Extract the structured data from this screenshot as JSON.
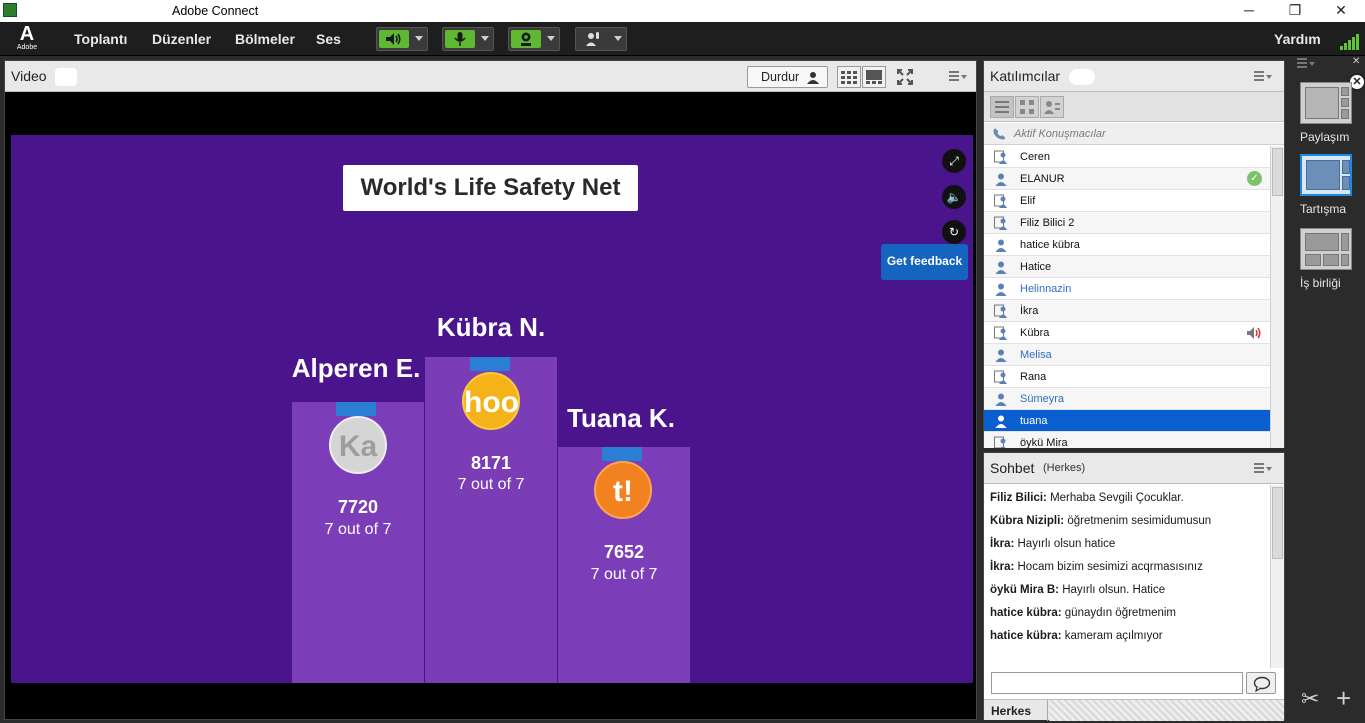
{
  "window": {
    "title": "Adobe Connect",
    "controls": [
      "─",
      "❐",
      "✕"
    ]
  },
  "menubar": {
    "logo_letter": "A",
    "logo_text": "Adobe",
    "items": [
      "Toplantı",
      "Düzenler",
      "Bölmeler",
      "Ses"
    ],
    "help": "Yardım"
  },
  "video": {
    "title": "Video",
    "stop_label": "Durdur",
    "stage": {
      "banner": "World's Life Safety Net",
      "feedback": "Get feedback",
      "podium": [
        {
          "name": "Alperen E.",
          "badge": "Ka",
          "score": "7720",
          "correct": "7 out of 7"
        },
        {
          "name": "Kübra N.",
          "badge": "hoo",
          "score": "8171",
          "correct": "7 out of 7"
        },
        {
          "name": "Tuana K.",
          "badge": "t!",
          "score": "7652",
          "correct": "7 out of 7"
        }
      ]
    }
  },
  "participants": {
    "title": "Katılımcılar",
    "active_speakers": "Aktif Konuşmacılar",
    "list": [
      {
        "name": "Ceren",
        "role": "host",
        "status": ""
      },
      {
        "name": "ELANUR",
        "role": "participant",
        "status": "check-icon"
      },
      {
        "name": "Elif",
        "role": "host",
        "status": ""
      },
      {
        "name": "Filiz Bilici 2",
        "role": "host",
        "status": ""
      },
      {
        "name": "hatice kübra",
        "role": "participant",
        "status": ""
      },
      {
        "name": "Hatice",
        "role": "participant",
        "status": ""
      },
      {
        "name": "Helinnazin",
        "role": "participant",
        "status": ""
      },
      {
        "name": "İkra",
        "role": "host",
        "status": ""
      },
      {
        "name": "Kübra",
        "role": "host",
        "status": "speaker-icon"
      },
      {
        "name": "Melisa",
        "role": "participant",
        "status": ""
      },
      {
        "name": "Rana",
        "role": "host",
        "status": ""
      },
      {
        "name": "Sümeyra",
        "role": "participant",
        "status": ""
      },
      {
        "name": "tuana",
        "role": "participant",
        "status": ""
      },
      {
        "name": "öykü Mira",
        "role": "host",
        "status": ""
      }
    ]
  },
  "chat": {
    "title": "Sohbet",
    "audience": "(Herkes)",
    "messages": [
      {
        "sender": "Filiz Bilici:",
        "text": "Merhaba Sevgili Çocuklar."
      },
      {
        "sender": "Kübra Nizipli:",
        "text": "öğretmenim sesimidumusun"
      },
      {
        "sender": "İkra:",
        "text": "Hayırlı olsun hatice"
      },
      {
        "sender": "İkra:",
        "text": "Hocam bizim sesimizi acqrmasısınız"
      },
      {
        "sender": "öykü Mira B:",
        "text": "Hayırlı olsun. Hatice"
      },
      {
        "sender": "hatice kübra:",
        "text": "günaydın öğretmenim"
      },
      {
        "sender": "hatice kübra:",
        "text": "kameram açılmıyor"
      }
    ],
    "input_value": "",
    "target": "Herkes"
  },
  "layouts": [
    {
      "label": "Paylaşım",
      "selected": false
    },
    {
      "label": "Tartışma",
      "selected": true
    },
    {
      "label": "İş birliği",
      "selected": false
    }
  ],
  "colors": {
    "stage": "#4a148c",
    "selection": "#0a5fd0",
    "accent_green": "#5fc33a",
    "feedback": "#1565c0"
  }
}
